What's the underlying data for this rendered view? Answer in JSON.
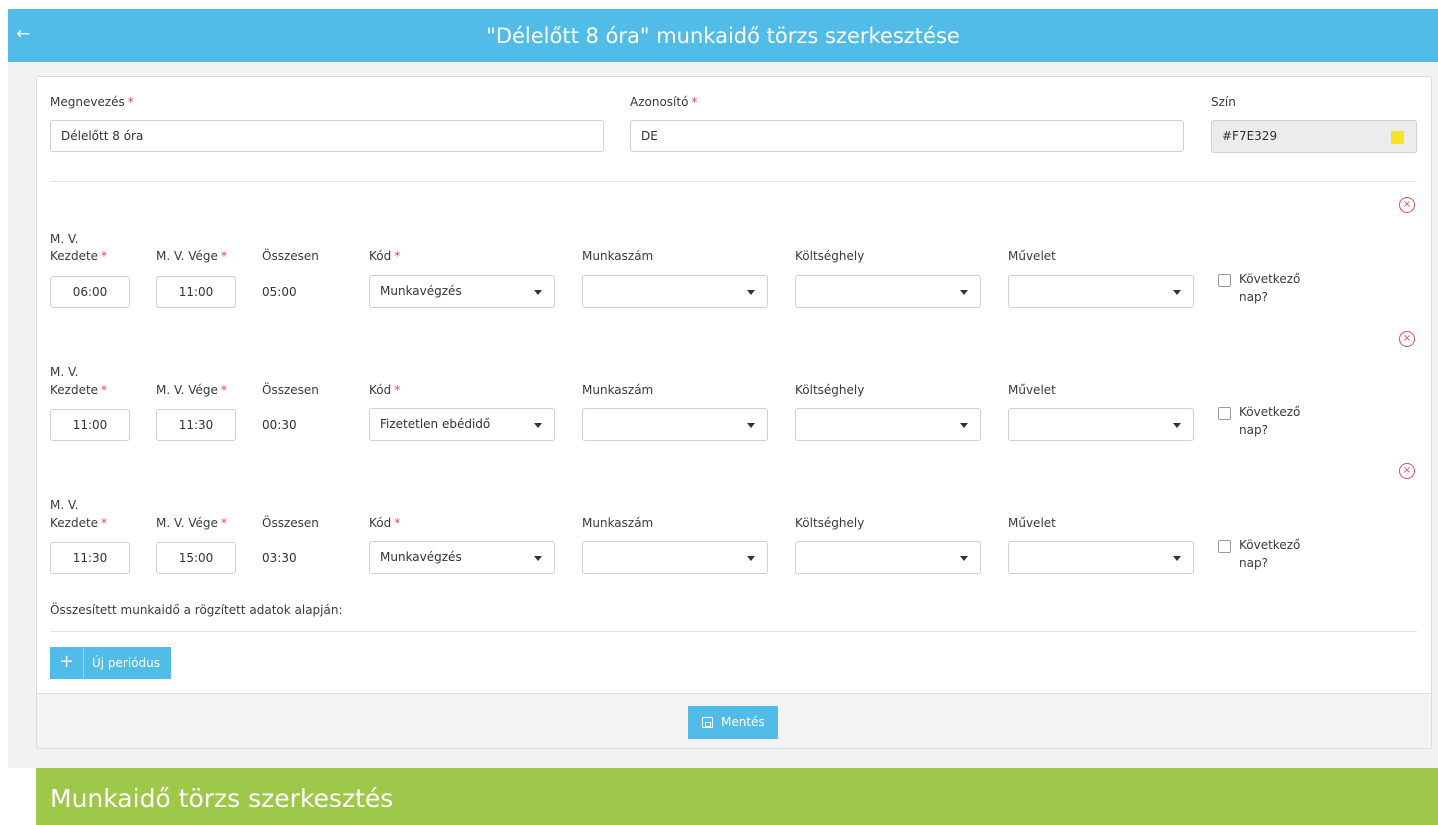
{
  "header": {
    "back_icon": "←",
    "title": "\"Délelőtt 8 óra\" munkaidő törzs szerkesztése"
  },
  "form": {
    "name_label": "Megnevezés",
    "name_value": "Délelőtt 8 óra",
    "id_label": "Azonosító",
    "id_value": "DE",
    "color_label": "Szín",
    "color_value": "#F7E329",
    "required_mark": "*"
  },
  "period_headers": {
    "start_line1": "M. V.",
    "start_line2": "Kezdete",
    "end": "M. V. Vége",
    "total": "Összesen",
    "code": "Kód",
    "job_number": "Munkaszám",
    "cost_center": "Költséghely",
    "operation": "Művelet",
    "next_day_line1": "Következő",
    "next_day_line2": "nap?"
  },
  "periods": [
    {
      "start": "06:00",
      "end": "11:00",
      "total": "05:00",
      "code": "Munkavégzés",
      "job_number": "",
      "cost_center": "",
      "operation": "",
      "next_day": false
    },
    {
      "start": "11:00",
      "end": "11:30",
      "total": "00:30",
      "code": "Fizetetlen ebédidő",
      "job_number": "",
      "cost_center": "",
      "operation": "",
      "next_day": false
    },
    {
      "start": "11:30",
      "end": "15:00",
      "total": "03:30",
      "code": "Munkavégzés",
      "job_number": "",
      "cost_center": "",
      "operation": "",
      "next_day": false
    }
  ],
  "remove_icon": "×",
  "summary_text": "Összesített munkaidő a rögzített adatok alapján:",
  "add_button": {
    "icon": "+",
    "label": "Új periódus"
  },
  "save_button": {
    "label": "Mentés"
  },
  "footer_banner": {
    "title": "Munkaidő törzs szerkesztés"
  },
  "colors": {
    "primary": "#52bce8",
    "green": "#9ec84a",
    "danger": "#e05050",
    "swatch": "#F7E329"
  }
}
